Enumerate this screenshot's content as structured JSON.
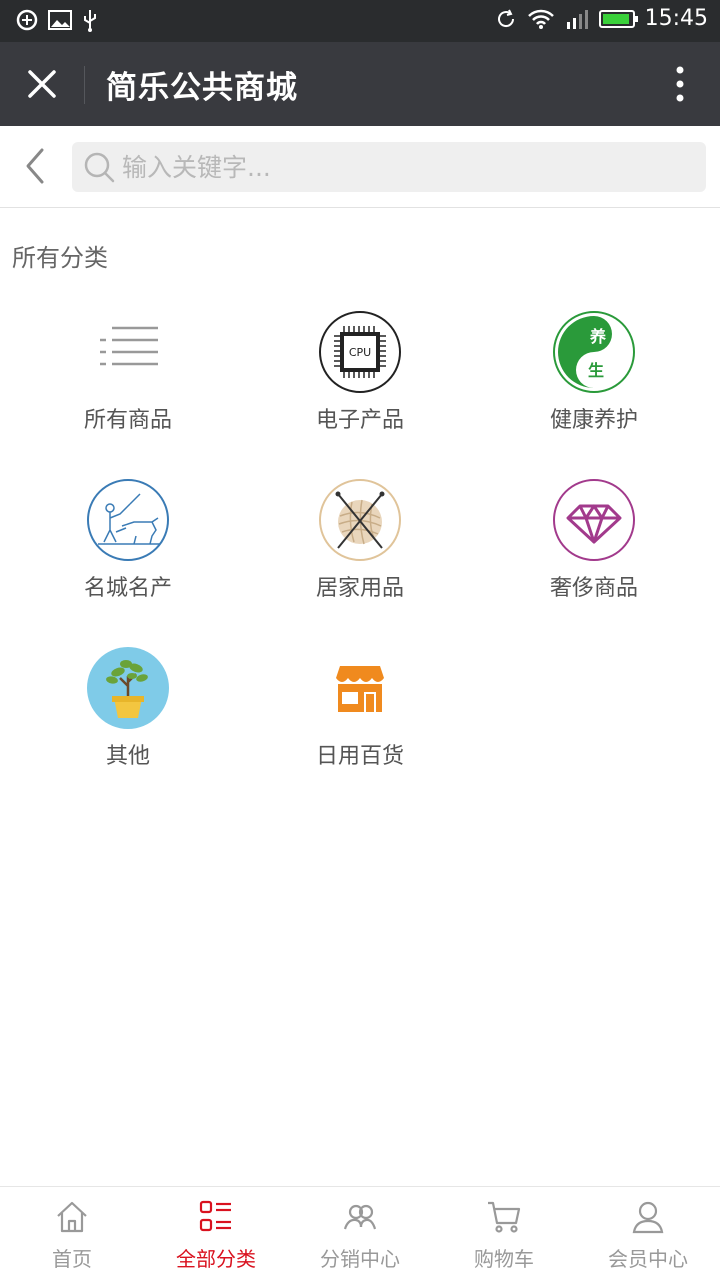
{
  "status_bar": {
    "time": "15:45"
  },
  "title_bar": {
    "title": "简乐公共商城"
  },
  "search": {
    "placeholder": "输入关键字..."
  },
  "section": {
    "title": "所有分类"
  },
  "categories": [
    {
      "label": "所有商品",
      "icon": "list-icon"
    },
    {
      "label": "电子产品",
      "icon": "cpu-chip-icon",
      "icon_text": "CPU"
    },
    {
      "label": "健康养护",
      "icon": "yin-yang-health-icon",
      "icon_text_1": "养",
      "icon_text_2": "生"
    },
    {
      "label": "名城名产",
      "icon": "farmer-ox-sketch-icon"
    },
    {
      "label": "居家用品",
      "icon": "yarn-ball-icon"
    },
    {
      "label": "奢侈商品",
      "icon": "diamond-icon"
    },
    {
      "label": "其他",
      "icon": "potted-plant-icon"
    },
    {
      "label": "日用百货",
      "icon": "storefront-icon"
    }
  ],
  "bottom_nav": [
    {
      "label": "首页",
      "icon": "home-icon",
      "active": false
    },
    {
      "label": "全部分类",
      "icon": "category-list-icon",
      "active": true
    },
    {
      "label": "分销中心",
      "icon": "users-icon",
      "active": false
    },
    {
      "label": "购物车",
      "icon": "cart-icon",
      "active": false
    },
    {
      "label": "会员中心",
      "icon": "person-icon",
      "active": false
    }
  ],
  "colors": {
    "status_bar_bg": "#2a2c2e",
    "title_bar_bg": "#393a3f",
    "active_nav": "#d9121f",
    "inactive_nav": "#999999",
    "battery": "#3ad03a"
  }
}
